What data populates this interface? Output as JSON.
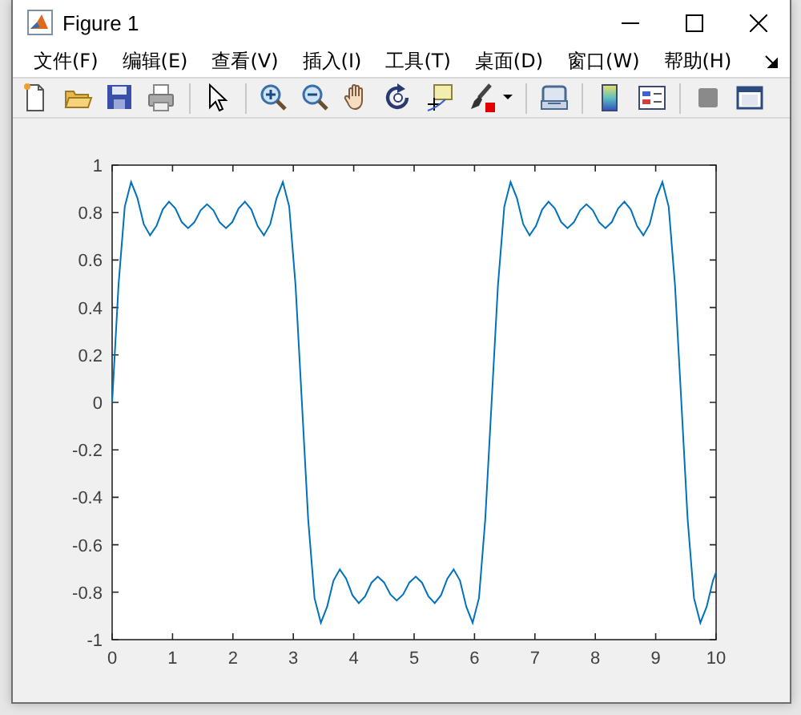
{
  "window": {
    "title": "Figure 1"
  },
  "menu": [
    "文件(F)",
    "编辑(E)",
    "查看(V)",
    "插入(I)",
    "工具(T)",
    "桌面(D)",
    "窗口(W)",
    "帮助(H)"
  ],
  "axes": {
    "chart_data": {
      "type": "line",
      "x": [
        0,
        0.105,
        0.209,
        0.314,
        0.419,
        0.524,
        0.628,
        0.733,
        0.838,
        0.942,
        1.047,
        1.152,
        1.257,
        1.361,
        1.466,
        1.571,
        1.676,
        1.78,
        1.885,
        1.99,
        2.094,
        2.199,
        2.304,
        2.409,
        2.513,
        2.618,
        2.723,
        2.827,
        2.932,
        3.037,
        3.142,
        3.246,
        3.351,
        3.456,
        3.56,
        3.665,
        3.77,
        3.875,
        3.979,
        4.084,
        4.189,
        4.294,
        4.398,
        4.503,
        4.608,
        4.712,
        4.817,
        4.922,
        5.027,
        5.131,
        5.236,
        5.341,
        5.445,
        5.55,
        5.655,
        5.76,
        5.864,
        5.969,
        6.074,
        6.178,
        6.283,
        6.388,
        6.493,
        6.597,
        6.702,
        6.807,
        6.912,
        7.016,
        7.121,
        7.226,
        7.33,
        7.435,
        7.54,
        7.645,
        7.749,
        7.854,
        7.959,
        8.063,
        8.168,
        8.273,
        8.378,
        8.482,
        8.587,
        8.692,
        8.796,
        8.901,
        9.006,
        9.111,
        9.215,
        9.32,
        9.425,
        9.529,
        9.634,
        9.739,
        9.844,
        9.948,
        10
      ],
      "series": [
        {
          "color": "#0072bd",
          "values": [
            0,
            0.493,
            0.825,
            0.929,
            0.861,
            0.751,
            0.704,
            0.743,
            0.813,
            0.846,
            0.817,
            0.76,
            0.734,
            0.759,
            0.81,
            0.835,
            0.81,
            0.759,
            0.734,
            0.76,
            0.817,
            0.846,
            0.813,
            0.743,
            0.704,
            0.751,
            0.861,
            0.929,
            0.825,
            0.493,
            0,
            -0.493,
            -0.825,
            -0.929,
            -0.861,
            -0.751,
            -0.704,
            -0.743,
            -0.813,
            -0.846,
            -0.817,
            -0.76,
            -0.734,
            -0.759,
            -0.81,
            -0.835,
            -0.81,
            -0.759,
            -0.734,
            -0.76,
            -0.817,
            -0.846,
            -0.813,
            -0.743,
            -0.704,
            -0.751,
            -0.861,
            -0.929,
            -0.825,
            -0.493,
            0,
            0.493,
            0.825,
            0.929,
            0.861,
            0.751,
            0.704,
            0.743,
            0.813,
            0.846,
            0.817,
            0.76,
            0.734,
            0.759,
            0.81,
            0.835,
            0.81,
            0.759,
            0.734,
            0.76,
            0.817,
            0.846,
            0.813,
            0.743,
            0.704,
            0.751,
            0.861,
            0.929,
            0.825,
            0.493,
            0,
            -0.493,
            -0.825,
            -0.929,
            -0.861,
            -0.751,
            -0.716
          ]
        }
      ],
      "xlim": [
        0,
        10
      ],
      "ylim": [
        -1,
        1
      ],
      "xticks": [
        0,
        1,
        2,
        3,
        4,
        5,
        6,
        7,
        8,
        9,
        10
      ],
      "yticks": [
        -1,
        -0.8,
        -0.6,
        -0.4,
        -0.2,
        0,
        0.2,
        0.4,
        0.6,
        0.8,
        1
      ]
    }
  }
}
